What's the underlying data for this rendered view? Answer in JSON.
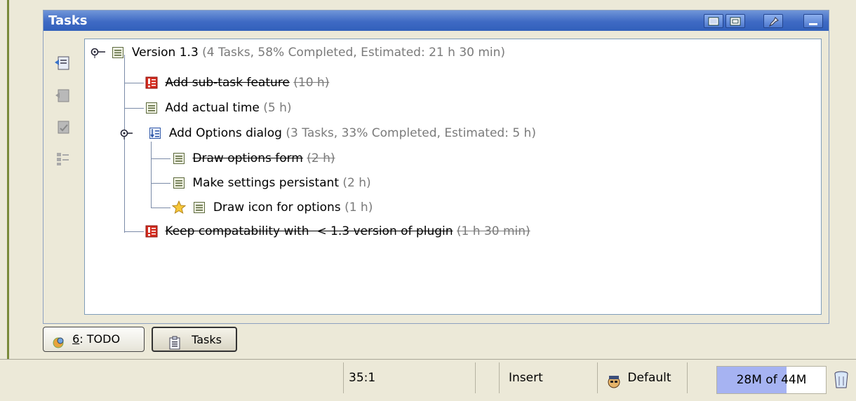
{
  "panel": {
    "title": "Tasks",
    "toolbar_icons": [
      "window-icon",
      "restore-icon",
      "pin-icon",
      "minimize-icon"
    ]
  },
  "side_tools": [
    "add-task-icon",
    "edit-task-icon",
    "complete-task-icon",
    "sort-tasks-icon"
  ],
  "tree": {
    "root": {
      "label": "Version 1.3",
      "detail": "(4 Tasks, 58% Completed, Estimated: 21 h 30 min)"
    },
    "items": [
      {
        "label": "Add sub-task feature",
        "detail": "(10 h)"
      },
      {
        "label": "Add actual time",
        "detail": "(5 h)"
      },
      {
        "label": "Add Options dialog",
        "detail": "(3 Tasks, 33% Completed, Estimated: 5 h)",
        "children": [
          {
            "label": "Draw options form",
            "detail": "(2 h)"
          },
          {
            "label": "Make settings persistant",
            "detail": "(2 h)"
          },
          {
            "label": "Draw icon for options",
            "detail": "(1 h)"
          }
        ]
      },
      {
        "label": "Keep compatability with  < 1.3 version of plugin",
        "detail": "(1 h 30 min)"
      }
    ]
  },
  "tabs": [
    {
      "label": "6: TODO",
      "mnemonic": "6",
      "rest": ": TODO"
    },
    {
      "label": "Tasks"
    }
  ],
  "status": {
    "position": "35:1",
    "mode": "Insert",
    "scheme": "Default",
    "memory": {
      "text": "28M of 44M",
      "used": 28,
      "total": 44
    }
  },
  "colors": {
    "accent": "#3f6ac4",
    "priority_high": "#d42b1e",
    "memory_fill": "#a6b3f2"
  }
}
